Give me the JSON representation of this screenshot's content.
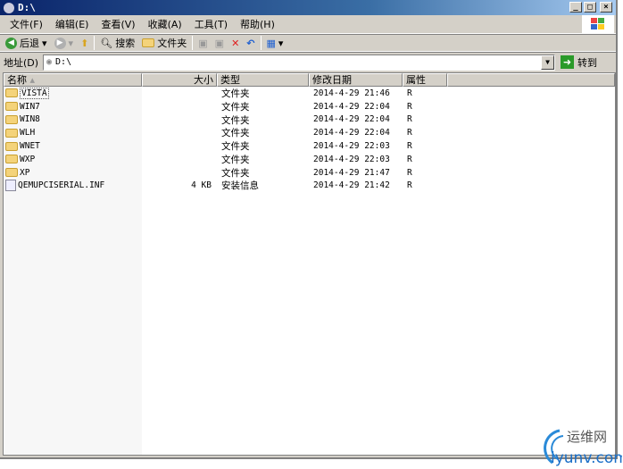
{
  "window": {
    "title": "D:\\",
    "buttons": [
      "_",
      "□",
      "×"
    ]
  },
  "menu": [
    "文件(F)",
    "编辑(E)",
    "查看(V)",
    "收藏(A)",
    "工具(T)",
    "帮助(H)"
  ],
  "toolbar": {
    "back": "后退",
    "search": "搜索",
    "folders": "文件夹"
  },
  "address": {
    "label": "地址(D)",
    "value": "D:\\",
    "go": "转到"
  },
  "columns": [
    "名称",
    "大小",
    "类型",
    "修改日期",
    "属性"
  ],
  "files": [
    {
      "name": "VISTA",
      "size": "",
      "type": "文件夹",
      "date": "2014-4-29 21:46",
      "attr": "R",
      "kind": "folder"
    },
    {
      "name": "WIN7",
      "size": "",
      "type": "文件夹",
      "date": "2014-4-29 22:04",
      "attr": "R",
      "kind": "folder"
    },
    {
      "name": "WIN8",
      "size": "",
      "type": "文件夹",
      "date": "2014-4-29 22:04",
      "attr": "R",
      "kind": "folder"
    },
    {
      "name": "WLH",
      "size": "",
      "type": "文件夹",
      "date": "2014-4-29 22:04",
      "attr": "R",
      "kind": "folder"
    },
    {
      "name": "WNET",
      "size": "",
      "type": "文件夹",
      "date": "2014-4-29 22:03",
      "attr": "R",
      "kind": "folder"
    },
    {
      "name": "WXP",
      "size": "",
      "type": "文件夹",
      "date": "2014-4-29 22:03",
      "attr": "R",
      "kind": "folder"
    },
    {
      "name": "XP",
      "size": "",
      "type": "文件夹",
      "date": "2014-4-29 21:47",
      "attr": "R",
      "kind": "folder"
    },
    {
      "name": "QEMUPCISERIAL.INF",
      "size": "4 KB",
      "type": "安装信息",
      "date": "2014-4-29 21:42",
      "attr": "R",
      "kind": "file"
    }
  ],
  "watermark": {
    "cn": "运维网",
    "url": "iyunv.com"
  }
}
